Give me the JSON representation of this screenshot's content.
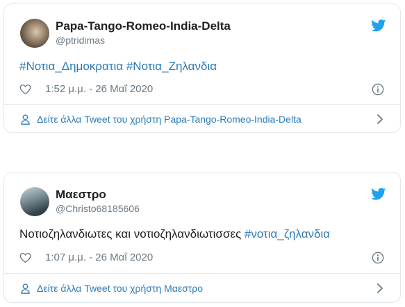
{
  "tweets": [
    {
      "name": "Papa-Tango-Romeo-India-Delta",
      "handle": "@ptridimas",
      "text_plain": "",
      "hashtags": [
        "#Νοτια_Δημοκρατια",
        "#Νοτια_Ζηλανδια"
      ],
      "timestamp": "1:52 μ.μ. - 26 Μαΐ 2020",
      "more_link": "Δείτε άλλα Tweet του χρήστη Papa-Tango-Romeo-India-Delta"
    },
    {
      "name": "Μαεστρο",
      "handle": "@Christo68185606",
      "text_plain": "Νοτιοζηλανδιωτες και νοτιοζηλανδιωτισσες ",
      "hashtags": [
        "#νοτια_ζηλανδια"
      ],
      "timestamp": "1:07 μ.μ. - 26 Μαΐ 2020",
      "more_link": "Δείτε άλλα Tweet του χρήστη Μαεστρο"
    }
  ],
  "colors": {
    "link": "#2b7bb9",
    "twitter_blue": "#1da1f2",
    "muted": "#697882",
    "border": "#e1e8ed"
  },
  "icons": {
    "bird": "twitter-bird-icon",
    "heart": "heart-icon",
    "info": "info-icon",
    "person": "person-icon",
    "chevron": "chevron-right-icon"
  }
}
